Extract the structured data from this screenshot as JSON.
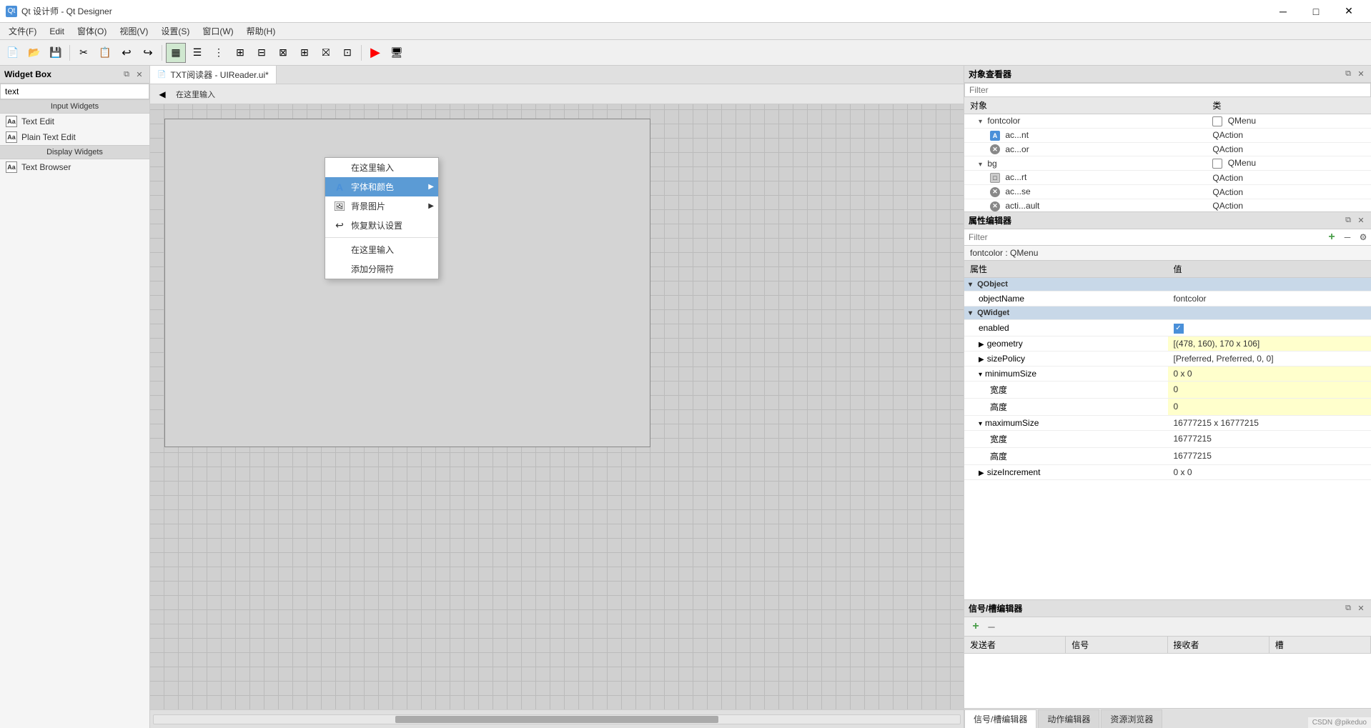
{
  "window": {
    "title": "Qt 设计师 - Qt Designer",
    "icon": "Qt"
  },
  "titlebar": {
    "text": "Qt 设计师 - Qt Designer",
    "minimize": "─",
    "maximize": "□",
    "close": "✕"
  },
  "menubar": {
    "items": [
      "文件(F)",
      "Edit",
      "窗体(O)",
      "视图(V)",
      "设置(S)",
      "窗口(W)",
      "帮助(H)"
    ]
  },
  "toolbar": {
    "buttons": [
      "📄",
      "📁",
      "💾",
      "✂",
      "📋",
      "↩",
      "↪",
      "🔧",
      "▶",
      "⏹",
      "🔍",
      "📦",
      "🔌",
      "🔲",
      "🔳",
      "⚙"
    ]
  },
  "widget_box": {
    "title": "Widget Box",
    "search_placeholder": "text",
    "sections": [
      {
        "name": "Input Widgets",
        "items": [
          {
            "label": "Text Edit",
            "icon": "Aa"
          },
          {
            "label": "Plain Text Edit",
            "icon": "Aa"
          },
          {
            "label": "Display Widgets",
            "icon": ""
          },
          {
            "label": "Text Browser",
            "icon": "Aa"
          }
        ]
      }
    ]
  },
  "canvas": {
    "tab_label": "TXT阅读器 - UIReader.ui*",
    "toolbar_text": "在这里输入"
  },
  "context_menu": {
    "items": [
      {
        "label": "在这里输入",
        "icon": "",
        "has_sub": false
      },
      {
        "label": "字体和颜色",
        "icon": "A",
        "has_sub": true,
        "active": true
      },
      {
        "label": "背景图片",
        "icon": "🖼",
        "has_sub": true
      },
      {
        "label": "恢复默认设置",
        "icon": "↩"
      },
      {
        "label": "在这里输入",
        "icon": ""
      },
      {
        "label": "添加分隔符",
        "icon": ""
      }
    ]
  },
  "object_inspector": {
    "title": "对象查看器",
    "filter_placeholder": "Filter",
    "col_object": "对象",
    "col_class": "类",
    "rows": [
      {
        "indent": 1,
        "expand": true,
        "name": "fontcolor",
        "class": "QMenu"
      },
      {
        "indent": 2,
        "expand": false,
        "name": "ac...nt",
        "icon_type": "a",
        "class": "QAction"
      },
      {
        "indent": 2,
        "expand": false,
        "name": "ac...or",
        "icon_type": "x",
        "class": "QAction"
      },
      {
        "indent": 1,
        "expand": true,
        "name": "bg",
        "class": "QMenu"
      },
      {
        "indent": 2,
        "expand": false,
        "name": "ac...rt",
        "icon_type": "f",
        "class": "QAction"
      },
      {
        "indent": 2,
        "expand": false,
        "name": "ac...se",
        "icon_type": "x",
        "class": "QAction"
      },
      {
        "indent": 2,
        "expand": false,
        "name": "acti...ault",
        "icon_type": "x",
        "class": "QAction"
      }
    ]
  },
  "property_editor": {
    "title": "属性编辑器",
    "filter_placeholder": "Filter",
    "context": "fontcolor : QMenu",
    "col_property": "属性",
    "col_value": "值",
    "sections": [
      {
        "name": "QObject",
        "properties": [
          {
            "name": "objectName",
            "value": "fontcolor",
            "indent": 1,
            "highlight": false
          }
        ]
      },
      {
        "name": "QWidget",
        "properties": [
          {
            "name": "enabled",
            "value": "☑",
            "indent": 1,
            "highlight": false,
            "is_checkbox": true
          },
          {
            "name": "geometry",
            "value": "[(478, 160), 170 x 106]",
            "indent": 1,
            "highlight": true,
            "expandable": true
          },
          {
            "name": "sizePolicy",
            "value": "[Preferred, Preferred, 0, 0]",
            "indent": 1,
            "highlight": false,
            "expandable": true
          },
          {
            "name": "minimumSize",
            "value": "0 x 0",
            "indent": 1,
            "highlight": true,
            "expandable": true,
            "expanded": true
          },
          {
            "name": "宽度",
            "value": "0",
            "indent": 2,
            "highlight": true
          },
          {
            "name": "高度",
            "value": "0",
            "indent": 2,
            "highlight": true
          },
          {
            "name": "maximumSize",
            "value": "16777215 x 16777215",
            "indent": 1,
            "highlight": false,
            "expandable": true,
            "expanded": true
          },
          {
            "name": "宽度",
            "value": "16777215",
            "indent": 2,
            "highlight": false
          },
          {
            "name": "高度",
            "value": "16777215",
            "indent": 2,
            "highlight": false
          },
          {
            "name": "sizeIncrement",
            "value": "0 x 0",
            "indent": 1,
            "highlight": false,
            "expandable": true
          }
        ]
      }
    ]
  },
  "signal_editor": {
    "title": "信号/槽编辑器",
    "cols": [
      "发送者",
      "信号",
      "接收者",
      "槽"
    ],
    "tabs": [
      {
        "label": "信号/槽编辑器",
        "active": true
      },
      {
        "label": "动作编辑器"
      },
      {
        "label": "资源浏览器"
      }
    ]
  },
  "status_bar": {
    "text": "CSDN @pikeduo"
  }
}
